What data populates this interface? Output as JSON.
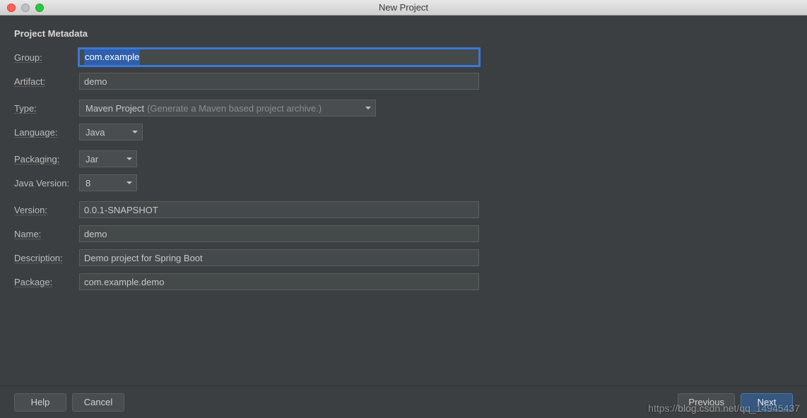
{
  "window": {
    "title": "New Project"
  },
  "section": {
    "title": "Project Metadata"
  },
  "fields": {
    "group": {
      "label": "Group:",
      "value": "com.example"
    },
    "artifact": {
      "label": "Artifact:",
      "value": "demo"
    },
    "type": {
      "label": "Type:",
      "value": "Maven Project",
      "hint": "(Generate a Maven based project archive.)"
    },
    "language": {
      "label": "Language:",
      "value": "Java"
    },
    "packaging": {
      "label": "Packaging:",
      "value": "Jar"
    },
    "javaVersion": {
      "label": "Java Version:",
      "value": "8"
    },
    "version": {
      "label": "Version:",
      "value": "0.0.1-SNAPSHOT"
    },
    "name": {
      "label": "Name:",
      "value": "demo"
    },
    "description": {
      "label": "Description:",
      "value": "Demo project for Spring Boot"
    },
    "package": {
      "label": "Package:",
      "value": "com.example.demo"
    }
  },
  "buttons": {
    "help": "Help",
    "cancel": "Cancel",
    "previous": "Previous",
    "next": "Next"
  },
  "watermark": "https://blog.csdn.net/qq_14945437"
}
